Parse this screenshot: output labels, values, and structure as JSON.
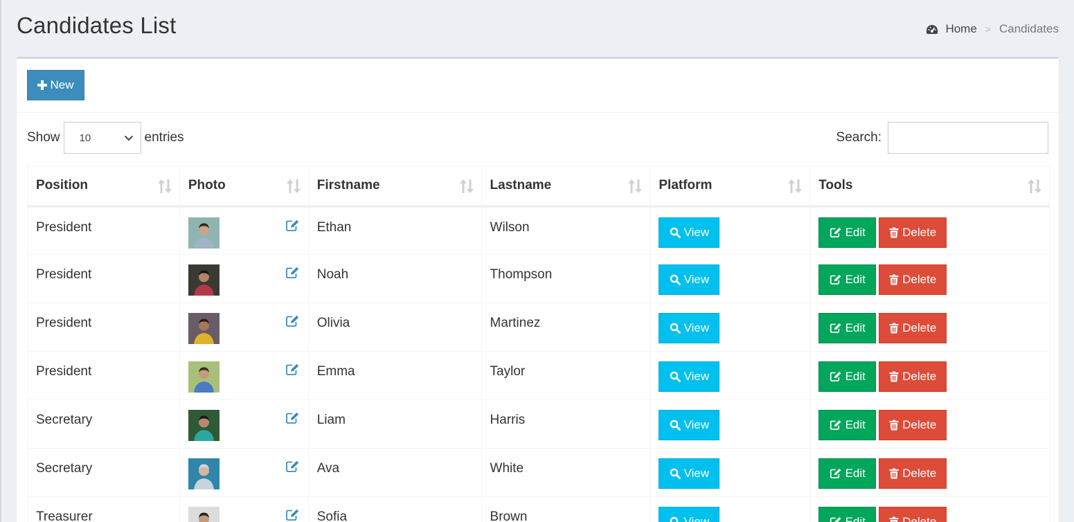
{
  "page": {
    "title": "Candidates List",
    "breadcrumb": {
      "home": "Home",
      "current": "Candidates"
    }
  },
  "toolbar": {
    "new_label": "New"
  },
  "datatable": {
    "show_label": "Show",
    "entries_label": "entries",
    "page_size": "10",
    "search_label": "Search:",
    "search_value": ""
  },
  "table": {
    "columns": [
      "Position",
      "Photo",
      "Firstname",
      "Lastname",
      "Platform",
      "Tools"
    ],
    "action_labels": {
      "view": "View",
      "edit": "Edit",
      "delete": "Delete"
    },
    "rows": [
      {
        "position": "President",
        "firstname": "Ethan",
        "lastname": "Wilson"
      },
      {
        "position": "President",
        "firstname": "Noah",
        "lastname": "Thompson"
      },
      {
        "position": "President",
        "firstname": "Olivia",
        "lastname": "Martinez"
      },
      {
        "position": "President",
        "firstname": "Emma",
        "lastname": "Taylor"
      },
      {
        "position": "Secretary",
        "firstname": "Liam",
        "lastname": "Harris"
      },
      {
        "position": "Secretary",
        "firstname": "Ava",
        "lastname": "White"
      },
      {
        "position": "Treasurer",
        "firstname": "Sofia",
        "lastname": "Brown"
      }
    ]
  },
  "colors": {
    "primary": "#3c8dbc",
    "info": "#00c0ef",
    "success": "#00a65a",
    "danger": "#dd4b39",
    "background": "#ecf0f5"
  },
  "icons": {
    "breadcrumb": "dashboard-icon",
    "new": "plus-icon",
    "sort": "sort-icon",
    "photo_edit": "edit-icon",
    "view": "search-icon",
    "edit": "edit-icon",
    "delete": "trash-icon"
  }
}
